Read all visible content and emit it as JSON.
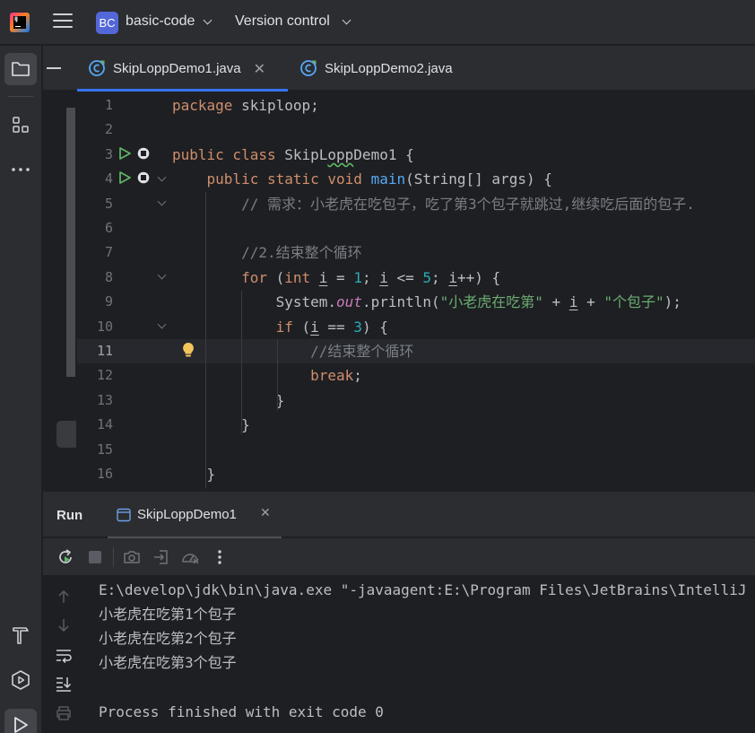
{
  "titlebar": {
    "app_icon": "intellij-idea-icon",
    "menu_icon": "hamburger-menu-icon",
    "project_badge": "BC",
    "project_name": "basic-code",
    "vcs_label": "Version control"
  },
  "tool_strip": {
    "top": [
      "folder-icon",
      "structure-icon",
      "more-icon"
    ],
    "bottom": [
      "build-hammer-icon",
      "services-icon",
      "run-icon"
    ]
  },
  "editor_tabs": [
    {
      "label": "SkipLoppDemo1.java",
      "active": true,
      "closable": true
    },
    {
      "label": "SkipLoppDemo2.java",
      "active": false,
      "closable": false
    }
  ],
  "editor": {
    "current_line": 11,
    "lines": [
      {
        "n": "1",
        "tokens": [
          {
            "t": "package",
            "c": "kw"
          },
          {
            "t": " skiploop;"
          }
        ]
      },
      {
        "n": "2",
        "tokens": []
      },
      {
        "n": "3",
        "tokens": [
          {
            "t": "public class",
            "c": "kw"
          },
          {
            "t": " SkipL"
          },
          {
            "t": "opp",
            "c": "squig"
          },
          {
            "t": "Demo1 {"
          }
        ]
      },
      {
        "n": "4",
        "tokens": [
          {
            "t": "    "
          },
          {
            "t": "public static void",
            "c": "kw"
          },
          {
            "t": " "
          },
          {
            "t": "main",
            "c": "fn"
          },
          {
            "t": "(String[] args) {"
          }
        ]
      },
      {
        "n": "5",
        "tokens": [
          {
            "t": "        "
          },
          {
            "t": "// 需求：小老虎在吃包子，吃了第3个包子就跳过,继续吃后面的包子.",
            "c": "cmt"
          }
        ]
      },
      {
        "n": "6",
        "tokens": []
      },
      {
        "n": "7",
        "tokens": [
          {
            "t": "        "
          },
          {
            "t": "//2.结束整个循环",
            "c": "cmt"
          }
        ]
      },
      {
        "n": "8",
        "tokens": [
          {
            "t": "        "
          },
          {
            "t": "for",
            "c": "kw"
          },
          {
            "t": " ("
          },
          {
            "t": "int",
            "c": "kw"
          },
          {
            "t": " "
          },
          {
            "t": "i",
            "c": "u"
          },
          {
            "t": " = "
          },
          {
            "t": "1",
            "c": "num"
          },
          {
            "t": "; "
          },
          {
            "t": "i",
            "c": "u"
          },
          {
            "t": " <= "
          },
          {
            "t": "5",
            "c": "num"
          },
          {
            "t": "; "
          },
          {
            "t": "i",
            "c": "u"
          },
          {
            "t": "++) {"
          }
        ]
      },
      {
        "n": "9",
        "tokens": [
          {
            "t": "            System."
          },
          {
            "t": "out",
            "c": "stat"
          },
          {
            "t": ".println("
          },
          {
            "t": "\"小老虎在吃第\"",
            "c": "str"
          },
          {
            "t": " + "
          },
          {
            "t": "i",
            "c": "u"
          },
          {
            "t": " + "
          },
          {
            "t": "\"个包子\"",
            "c": "str"
          },
          {
            "t": ");"
          }
        ]
      },
      {
        "n": "10",
        "tokens": [
          {
            "t": "            "
          },
          {
            "t": "if",
            "c": "kw"
          },
          {
            "t": " ("
          },
          {
            "t": "i",
            "c": "u"
          },
          {
            "t": " == "
          },
          {
            "t": "3",
            "c": "num"
          },
          {
            "t": ") {"
          }
        ]
      },
      {
        "n": "11",
        "tokens": [
          {
            "t": "                "
          },
          {
            "t": "//结束整个循环",
            "c": "cmt"
          }
        ]
      },
      {
        "n": "12",
        "tokens": [
          {
            "t": "                "
          },
          {
            "t": "break",
            "c": "kw"
          },
          {
            "t": ";"
          }
        ]
      },
      {
        "n": "13",
        "tokens": [
          {
            "t": "            }"
          }
        ]
      },
      {
        "n": "14",
        "tokens": [
          {
            "t": "        }"
          }
        ]
      },
      {
        "n": "15",
        "tokens": []
      },
      {
        "n": "16",
        "tokens": [
          {
            "t": "    }"
          }
        ]
      }
    ]
  },
  "run_panel": {
    "title": "Run",
    "tab_label": "SkipLoppDemo1",
    "toolbar": [
      "rerun-icon",
      "stop-icon",
      "screenshot-icon",
      "exit-icon",
      "dashboard-icon",
      "more-vertical-icon"
    ],
    "side_icons": [
      "arrow-up-icon",
      "arrow-down-icon",
      "soft-wrap-icon",
      "scroll-to-end-icon",
      "print-icon"
    ],
    "console_lines": [
      "E:\\develop\\jdk\\bin\\java.exe \"-javaagent:E:\\Program Files\\JetBrains\\IntelliJ",
      "小老虎在吃第1个包子",
      "小老虎在吃第2个包子",
      "小老虎在吃第3个包子",
      "",
      "Process finished with exit code 0"
    ]
  },
  "colors": {
    "accent": "#3574f0",
    "keyword": "#cf8e6d",
    "function": "#56a8f5",
    "number": "#2aacb8",
    "string": "#6aab73",
    "comment": "#7a7e85",
    "run_green": "#5fb865"
  }
}
